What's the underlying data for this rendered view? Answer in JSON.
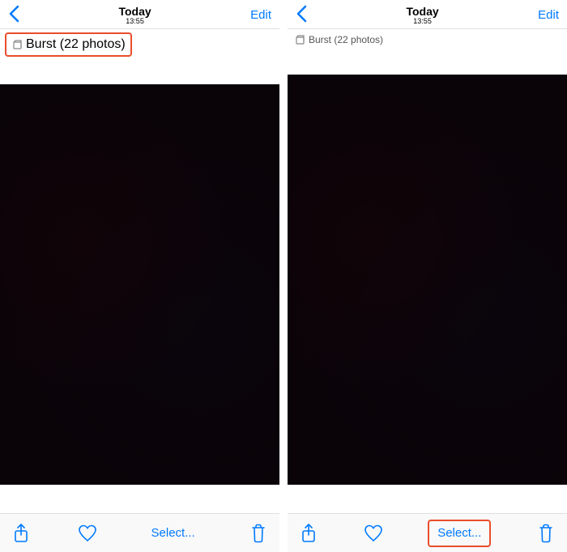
{
  "colors": {
    "accent": "#007aff",
    "highlight_border": "#e94e2c"
  },
  "left": {
    "header": {
      "title": "Today",
      "time": "13:55",
      "edit": "Edit"
    },
    "burst": {
      "icon": "burst-stack-icon",
      "label": "Burst (22 photos)"
    },
    "toolbar": {
      "share_icon": "share-icon",
      "favorite_icon": "heart-icon",
      "select_label": "Select...",
      "trash_icon": "trash-icon"
    }
  },
  "right": {
    "header": {
      "title": "Today",
      "time": "13:55",
      "edit": "Edit"
    },
    "burst": {
      "icon": "burst-stack-icon",
      "label": "Burst (22 photos)"
    },
    "toolbar": {
      "share_icon": "share-icon",
      "favorite_icon": "heart-icon",
      "select_label": "Select...",
      "trash_icon": "trash-icon"
    }
  }
}
